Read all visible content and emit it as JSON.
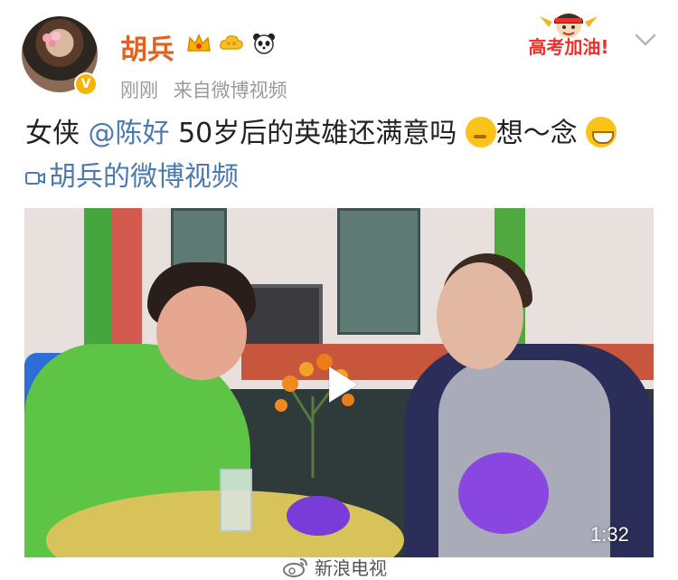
{
  "post": {
    "author": "胡兵",
    "time": "刚刚",
    "source": "来自微博视频",
    "text_before": "女侠 ",
    "mention": "@陈好",
    "text_middle": " 50岁后的英雄还满意吗 ",
    "text_after_emoji": "想～念 ",
    "video_link": "胡兵的微博视频"
  },
  "campaign_badge": "高考加油!",
  "video": {
    "duration": "1:32"
  },
  "watermark": {
    "text": "新浪电视"
  },
  "icons": {
    "crown": "crown-icon",
    "cloud": "cloud-icon",
    "panda": "panda-icon",
    "verify": "verified-icon",
    "chevron": "chevron-down-icon",
    "play": "play-icon",
    "video_link": "video-camera-icon",
    "weibo": "weibo-logo-icon"
  },
  "colors": {
    "username": "#e3611d",
    "link": "#4a7ab0",
    "meta": "#9a9a9a",
    "badge_red": "#e8322b"
  }
}
